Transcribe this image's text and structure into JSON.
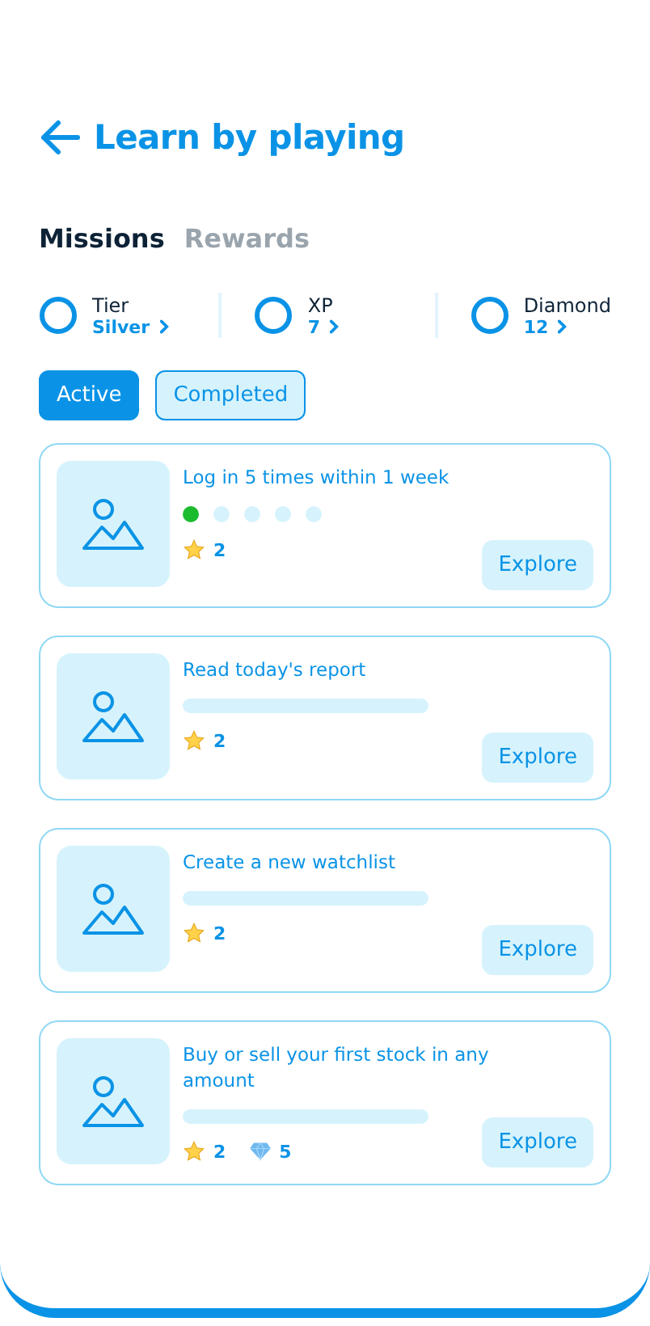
{
  "header": {
    "title": "Learn by playing"
  },
  "tabs": [
    {
      "label": "Missions",
      "selected": true
    },
    {
      "label": "Rewards",
      "selected": false
    }
  ],
  "stats": [
    {
      "label": "Tier",
      "value": "Silver"
    },
    {
      "label": "XP",
      "value": "7"
    },
    {
      "label": "Diamond",
      "value": "12"
    }
  ],
  "filters": [
    {
      "label": "Active",
      "selected": true
    },
    {
      "label": "Completed",
      "selected": false
    }
  ],
  "missions": [
    {
      "title": "Log in 5 times within 1 week",
      "progress": {
        "kind": "dots",
        "steps": [
          {
            "done": true
          },
          {
            "done": false
          },
          {
            "done": false
          },
          {
            "done": false
          },
          {
            "done": false
          }
        ]
      },
      "rewards": [
        {
          "kind": "star",
          "amount": "2"
        }
      ],
      "button": "Explore"
    },
    {
      "title": "Read today's report",
      "progress": {
        "kind": "bar",
        "level": 0
      },
      "rewards": [
        {
          "kind": "star",
          "amount": "2"
        }
      ],
      "button": "Explore"
    },
    {
      "title": "Create a new watchlist",
      "progress": {
        "kind": "bar",
        "level": 0
      },
      "rewards": [
        {
          "kind": "star",
          "amount": "2"
        }
      ],
      "button": "Explore"
    },
    {
      "title": "Buy or sell your first stock in any amount",
      "progress": {
        "kind": "bar",
        "level": 0
      },
      "rewards": [
        {
          "kind": "star",
          "amount": "2"
        },
        {
          "kind": "diamond",
          "amount": "5"
        }
      ],
      "button": "Explore"
    }
  ]
}
